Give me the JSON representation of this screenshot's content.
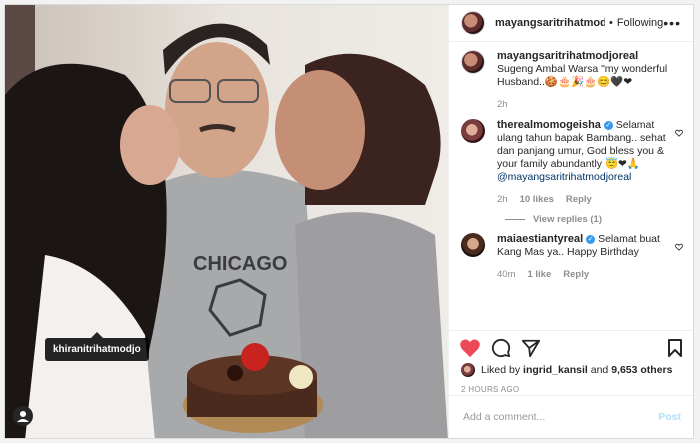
{
  "post": {
    "username": "mayangsaritrihatmodjo",
    "separator": "•",
    "follow_status": "Following",
    "more_icon": "ellipsis-icon"
  },
  "photo": {
    "tag_label": "khiranitrihatmodjo",
    "shirt_text": "CHICAGO"
  },
  "comments": [
    {
      "username": "mayangsaritrihatmodjoreal",
      "text": "Sugeng Ambal Warsa \"my wonderful Husband..",
      "emojis": "🍪🎂🎉🎂😊🖤❤",
      "time": "2h"
    },
    {
      "username": "therealmomogeisha",
      "verified": true,
      "text": "Selamat ulang tahun bapak Bambang.. sehat dan panjang umur, God bless you & your family abundantly",
      "emojis": "😇❤🙏",
      "mention": "@mayangsaritrihatmodjoreal",
      "time": "2h",
      "likes": "10 likes",
      "reply": "Reply",
      "view_replies": "View replies (1)"
    },
    {
      "username": "maiaestiantyreal",
      "verified": true,
      "text": "Selamat buat Kang Mas ya.. Happy Birthday",
      "time": "40m",
      "likes": "1 like",
      "reply": "Reply"
    }
  ],
  "likes": {
    "prefix": "Liked by",
    "user": "ingrid_kansil",
    "middle": "and",
    "count": "9,653 others"
  },
  "timestamp": "2 HOURS AGO",
  "add_comment": {
    "placeholder": "Add a comment...",
    "post_label": "Post"
  },
  "colors": {
    "accent": "#3897f0",
    "heart": "#ed4956",
    "post_disabled": "#b2dffc"
  }
}
